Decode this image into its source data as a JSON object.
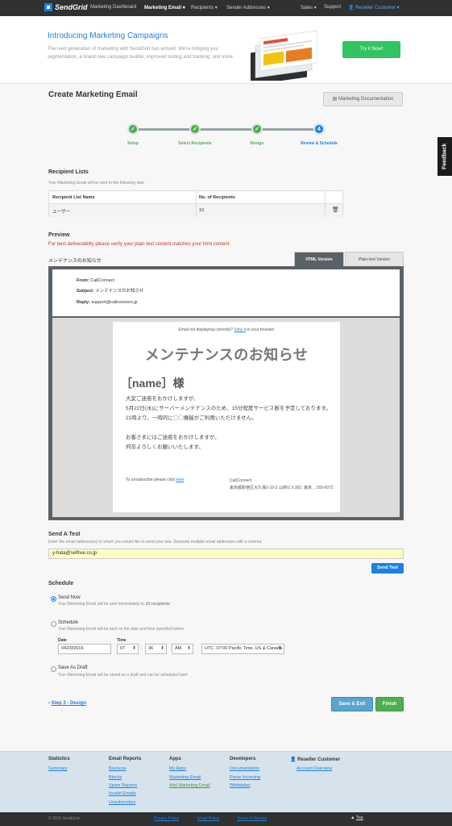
{
  "topnav": {
    "logo": "SendGrid",
    "items": [
      "Marketing Dashboard",
      "Marketing Email",
      "Recipients",
      "Sender Addresses"
    ],
    "right": [
      "Sales",
      "Support",
      "Reseller Customer"
    ]
  },
  "banner": {
    "title": "Introducing Marketing Campaigns",
    "desc": "The next generation of marketing with SendGrid has arrived. We're bringing you segmentation, a brand new campaign builder, improved testing and tracking, and more.",
    "cta": "Try it Now!"
  },
  "page": {
    "title": "Create Marketing Email",
    "doc_button": "Marketing Documentation"
  },
  "steps": [
    {
      "label": "Setup",
      "state": "done"
    },
    {
      "label": "Select Recipients",
      "state": "done"
    },
    {
      "label": "Design",
      "state": "done"
    },
    {
      "label": "Review & Schedule",
      "state": "current",
      "number": "4"
    }
  ],
  "feedback": "Feedback",
  "recipients": {
    "heading": "Recipient Lists",
    "sub": "Your Marketing Email will be sent to the following lists:",
    "columns": [
      "Recipient List Name",
      "No. of Recipients"
    ],
    "rows": [
      {
        "name": "ユーザー",
        "count": "10"
      }
    ]
  },
  "preview": {
    "heading": "Preview",
    "warning": "For best deliverability please verify your plain text content matches your html content.",
    "subject_title": "メンテナンスのお知らせ",
    "tabs": [
      "HTML Version",
      "Plain-text Version"
    ],
    "from_label": "From:",
    "from": "CallConnect",
    "subject_label": "Subject:",
    "subject": "メンテナンスのお知らせ",
    "reply_label": "Reply:",
    "reply": "support@callconnect.jp",
    "email": {
      "notdisp_pre": "Email not displaying correctly?",
      "notdisp_link": "View it",
      "notdisp_post": "in your browser",
      "title": "メンテナンスのお知らせ",
      "name": "［name］様",
      "lines": [
        "大変ご迷惑をおかけしますが、",
        "5月22日(水)にサーバーメンテナンスのため、15分程度サービス断を予定しております。",
        "21時より、一時的に◯◯機能がご利用いただけません。",
        "",
        "お客さまにはご迷惑をおかけしますが、",
        "何卒よろしくお願いいたします。"
      ],
      "unsub_pre": "To unsubscribe please click",
      "unsub_link": "here",
      "addr_name": "CallConnect",
      "addr": "東京都新宿区大久保2-10-2 山崎ビル302, 東京, , 169-0072"
    }
  },
  "send_test": {
    "heading": "Send A Test",
    "sub": "Enter the email address(es) to which you would like to send your test. Separate multiple email addresses with a comma.",
    "value": "y-hata@selfree.co.jp",
    "button": "Send Test"
  },
  "schedule": {
    "heading": "Schedule",
    "send_now": "Send Now",
    "send_now_desc_pre": "Your Marketing Email will be sent immediately to",
    "send_now_desc_bold": "10 recipients",
    "schedule": "Schedule",
    "schedule_desc": "Your Marketing Email will be sent on the date and time specified below",
    "date_label": "Date",
    "time_label": "Time",
    "date": "04/29/2016",
    "hour": "07",
    "minute": "36",
    "ampm": "AM",
    "tz": "UTC -07:00 Pacific Time, US & Canada",
    "draft": "Save As Draft",
    "draft_desc": "Your Marketing Email will be saved as a draft and can be scheduled later"
  },
  "actions": {
    "back": "Step 3 - Design",
    "save_exit": "Save & Exit",
    "finish": "Finish"
  },
  "footer": {
    "cols": [
      {
        "title": "Statistics",
        "links": [
          "Summary"
        ]
      },
      {
        "title": "Email Reports",
        "links": [
          "Bounces",
          "Blocks",
          "Spam Reports",
          "Invalid Emails",
          "Unsubscribes"
        ]
      },
      {
        "title": "Apps",
        "links": [
          "My Apps",
          "Marketing Email",
          "Add Marketing Email"
        ]
      },
      {
        "title": "Developers",
        "links": [
          "Documentation",
          "Parse Incoming",
          "Whitelabel"
        ]
      },
      {
        "title": "Reseller Customer",
        "links": [
          "Account Overview"
        ]
      }
    ],
    "copyright": "© 2016 SendGrid",
    "bottom_links": [
      "Privacy Policy",
      "Email Policy",
      "Terms of Service"
    ],
    "top": "Top"
  }
}
